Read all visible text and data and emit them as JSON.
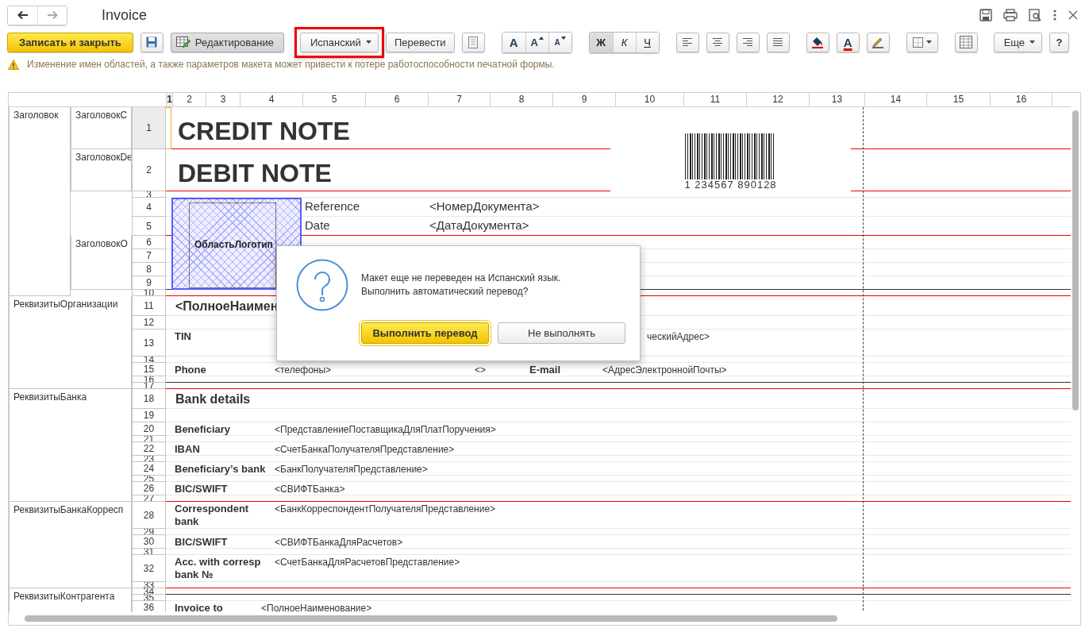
{
  "window": {
    "title": "Invoice"
  },
  "toolbar": [
    {
      "kind": "primary",
      "label": "Записать и закрыть"
    },
    {
      "kind": "save"
    },
    {
      "kind": "toggle",
      "label": "Редактирование",
      "on": true
    },
    {
      "kind": "dropdown",
      "label": "Испанский",
      "highlighted": true
    },
    {
      "kind": "button",
      "label": "Перевести"
    },
    {
      "kind": "page"
    },
    {
      "kind": "segmented",
      "buttons": [
        {
          "kind": "plain",
          "glyph": "A",
          "on": false
        },
        {
          "kind": "bigger",
          "glyph": "A",
          "on": false
        },
        {
          "kind": "smaller",
          "glyph": "A",
          "on": false
        }
      ]
    },
    {
      "kind": "segmented",
      "buttons": [
        {
          "kind": "bold",
          "glyph": "Ж",
          "on": true
        },
        {
          "kind": "italic",
          "glyph": "К",
          "on": false
        },
        {
          "kind": "underline",
          "glyph": "Ч",
          "on": false
        }
      ]
    },
    {
      "kind": "alignleft"
    },
    {
      "kind": "aligncenter"
    },
    {
      "kind": "alignright"
    },
    {
      "kind": "alignjustify"
    },
    {
      "kind": "fill"
    },
    {
      "kind": "fontcolor",
      "glyph": "A"
    },
    {
      "kind": "marker"
    },
    {
      "kind": "borders"
    },
    {
      "kind": "table"
    },
    {
      "kind": "dropdown",
      "label": "Еще",
      "highlighted": false
    },
    {
      "kind": "button",
      "label": "?"
    }
  ],
  "warning": "Изменение имен областей, а также параметров макета может привести к потере работоспособности печатной формы.",
  "sheet": {
    "columns": [
      {
        "label": "1",
        "selected": true
      },
      {
        "label": "2",
        "selected": false
      },
      {
        "label": "3",
        "selected": false
      },
      {
        "label": "4",
        "selected": false
      },
      {
        "label": "5",
        "selected": false
      },
      {
        "label": "6",
        "selected": false
      },
      {
        "label": "7",
        "selected": false
      },
      {
        "label": "8",
        "selected": false
      },
      {
        "label": "9",
        "selected": false
      },
      {
        "label": "10",
        "selected": false
      },
      {
        "label": "11",
        "selected": false
      },
      {
        "label": "12",
        "selected": false
      },
      {
        "label": "13",
        "selected": false
      },
      {
        "label": "14",
        "selected": false
      },
      {
        "label": "15",
        "selected": false
      },
      {
        "label": "16",
        "selected": false
      }
    ],
    "pictures": [
      {
        "kind": "barcode",
        "digits": "1 234567 890128"
      },
      {
        "kind": "logo",
        "label": "ОбластьЛоготип"
      }
    ],
    "sections": [
      {
        "label": "Заголовок",
        "blocks": [
          {
            "label": "ЗаголовокC",
            "rows": [
              {
                "number": "1",
                "kind": "title",
                "selected": true,
                "ruled": false,
                "cells": [
                  {
                    "kind": "title",
                    "text": "CREDIT NOTE"
                  }
                ]
              }
            ]
          },
          {
            "label": "ЗаголовокDe",
            "rows": [
              {
                "number": "2",
                "kind": "title",
                "selected": false,
                "ruled": false,
                "cells": [
                  {
                    "kind": "title",
                    "text": "DEBIT NOTE"
                  }
                ]
              }
            ]
          },
          {
            "rows": [
              {
                "number": "3",
                "kind": "thin",
                "selected": false,
                "ruled": false,
                "cells": []
              },
              {
                "number": "4",
                "kind": "ref",
                "selected": false,
                "ruled": false,
                "cells": [
                  {
                    "kind": "ref-label",
                    "text": "Reference"
                  },
                  {
                    "kind": "ref-value",
                    "text": "<НомерДокумента>"
                  }
                ]
              },
              {
                "number": "5",
                "kind": "ref",
                "selected": false,
                "ruled": false,
                "cells": [
                  {
                    "kind": "ref-label",
                    "text": "Date"
                  },
                  {
                    "kind": "ref-value",
                    "text": "<ДатаДокумента>"
                  }
                ]
              }
            ]
          },
          {
            "label": "ЗаголовокО",
            "rows": [
              {
                "number": "6",
                "kind": "small",
                "selected": false,
                "ruled": false,
                "cells": []
              },
              {
                "number": "7",
                "kind": "small",
                "selected": false,
                "ruled": false,
                "cells": []
              },
              {
                "number": "8",
                "kind": "small",
                "selected": false,
                "ruled": false,
                "cells": []
              },
              {
                "number": "9",
                "kind": "small",
                "selected": false,
                "ruled": true,
                "cells": []
              }
            ]
          },
          {
            "rows": [
              {
                "number": "10",
                "kind": "thin",
                "selected": false,
                "ruled": false,
                "cells": []
              }
            ]
          }
        ]
      },
      {
        "label": "РеквизитыОрганизации",
        "blocks": [
          {
            "rows": [
              {
                "number": "11",
                "kind": "heading",
                "selected": false,
                "ruled": false,
                "cells": [
                  {
                    "kind": "heading",
                    "text": "<ПолноеНаимен"
                  }
                ]
              },
              {
                "number": "12",
                "kind": "small",
                "selected": false,
                "ruled": false,
                "cells": []
              },
              {
                "number": "13",
                "kind": "double",
                "selected": false,
                "ruled": false,
                "cells": [
                  {
                    "kind": "label",
                    "text": "TIN"
                  },
                  {
                    "kind": "short",
                    "text": ""
                  },
                  {
                    "kind": "slot",
                    "text": ""
                  },
                  {
                    "kind": "email-label",
                    "text": ""
                  },
                  {
                    "kind": "tail",
                    "text": "ческийАдрес>"
                  }
                ]
              },
              {
                "number": "14",
                "kind": "thin",
                "selected": false,
                "ruled": false,
                "cells": []
              },
              {
                "number": "15",
                "kind": "small",
                "selected": false,
                "ruled": false,
                "cells": [
                  {
                    "kind": "label",
                    "text": "Phone"
                  },
                  {
                    "kind": "short",
                    "text": "<телефоны>"
                  },
                  {
                    "kind": "slot",
                    "text": "<>"
                  },
                  {
                    "kind": "email-label",
                    "text": "E-mail"
                  },
                  {
                    "kind": "email-value",
                    "text": "<АдресЭлектроннойПочты>"
                  }
                ]
              },
              {
                "number": "16",
                "kind": "thin",
                "selected": false,
                "ruled": true,
                "cells": []
              },
              {
                "number": "17",
                "kind": "thin",
                "selected": false,
                "ruled": false,
                "cells": []
              }
            ]
          }
        ]
      },
      {
        "label": "РеквизитыБанка",
        "blocks": [
          {
            "rows": [
              {
                "number": "18",
                "kind": "heading",
                "selected": false,
                "ruled": false,
                "cells": [
                  {
                    "kind": "heading",
                    "text": "Bank details"
                  }
                ]
              },
              {
                "number": "19",
                "kind": "small",
                "selected": false,
                "ruled": false,
                "cells": []
              },
              {
                "number": "20",
                "kind": "small",
                "selected": false,
                "ruled": false,
                "cells": [
                  {
                    "kind": "label",
                    "text": "Beneficiary"
                  },
                  {
                    "kind": "value",
                    "text": "<ПредставлениеПоставщикаДляПлатПоручения>"
                  }
                ]
              },
              {
                "number": "21",
                "kind": "thin",
                "selected": false,
                "ruled": false,
                "cells": []
              },
              {
                "number": "22",
                "kind": "small",
                "selected": false,
                "ruled": false,
                "cells": [
                  {
                    "kind": "label",
                    "text": "IBAN"
                  },
                  {
                    "kind": "value",
                    "text": "<СчетБанкаПолучателяПредставление>"
                  }
                ]
              },
              {
                "number": "23",
                "kind": "thin",
                "selected": false,
                "ruled": false,
                "cells": []
              },
              {
                "number": "24",
                "kind": "small",
                "selected": false,
                "ruled": false,
                "cells": [
                  {
                    "kind": "label",
                    "text": "Beneficiary’s bank"
                  },
                  {
                    "kind": "value",
                    "text": "<БанкПолучателяПредставление>"
                  }
                ]
              },
              {
                "number": "25",
                "kind": "thin",
                "selected": false,
                "ruled": false,
                "cells": []
              },
              {
                "number": "26",
                "kind": "small",
                "selected": false,
                "ruled": false,
                "cells": [
                  {
                    "kind": "label",
                    "text": "BIC/SWIFT"
                  },
                  {
                    "kind": "value",
                    "text": "<СВИФТБанка>"
                  }
                ]
              },
              {
                "number": "27",
                "kind": "thin",
                "selected": false,
                "ruled": false,
                "cells": []
              }
            ]
          }
        ]
      },
      {
        "label": "РеквизитыБанкаКорресп",
        "blocks": [
          {
            "rows": [
              {
                "number": "28",
                "kind": "double",
                "selected": false,
                "ruled": false,
                "cells": [
                  {
                    "kind": "label",
                    "text": "Correspondent bank"
                  },
                  {
                    "kind": "value",
                    "text": "<БанкКорреспондентПолучателяПредставление>"
                  }
                ]
              },
              {
                "number": "29",
                "kind": "thin",
                "selected": false,
                "ruled": false,
                "cells": []
              },
              {
                "number": "30",
                "kind": "small",
                "selected": false,
                "ruled": false,
                "cells": [
                  {
                    "kind": "label",
                    "text": "BIC/SWIFT"
                  },
                  {
                    "kind": "value",
                    "text": "<СВИФТБанкаДляРасчетов>"
                  }
                ]
              },
              {
                "number": "31",
                "kind": "thin",
                "selected": false,
                "ruled": false,
                "cells": []
              },
              {
                "number": "32",
                "kind": "double",
                "selected": false,
                "ruled": false,
                "cells": [
                  {
                    "kind": "label",
                    "text": "Acc. with corresp bank №"
                  },
                  {
                    "kind": "value",
                    "text": "<СчетБанкаДляРасчетовПредставление>"
                  }
                ]
              },
              {
                "number": "33",
                "kind": "thin",
                "selected": false,
                "ruled": false,
                "cells": []
              }
            ]
          }
        ]
      },
      {
        "label": "РеквизитыКонтрагента",
        "blocks": [
          {
            "rows": [
              {
                "number": "34",
                "kind": "thin",
                "selected": false,
                "ruled": true,
                "cells": []
              },
              {
                "number": "35",
                "kind": "thin",
                "selected": false,
                "ruled": false,
                "cells": []
              },
              {
                "number": "36",
                "kind": "small",
                "selected": false,
                "ruled": false,
                "cells": [
                  {
                    "kind": "party-label",
                    "text": "Invoice to"
                  },
                  {
                    "kind": "party-value",
                    "text": "<ПолноеНаименование>"
                  }
                ]
              }
            ]
          }
        ]
      }
    ]
  },
  "dialog": {
    "message_lines": [
      "Макет еще не переведен на Испанский язык.",
      "Выполнить автоматический перевод?"
    ],
    "buttons": [
      {
        "label": "Выполнить перевод",
        "default": true
      },
      {
        "label": "Не выполнять",
        "default": false
      }
    ]
  }
}
